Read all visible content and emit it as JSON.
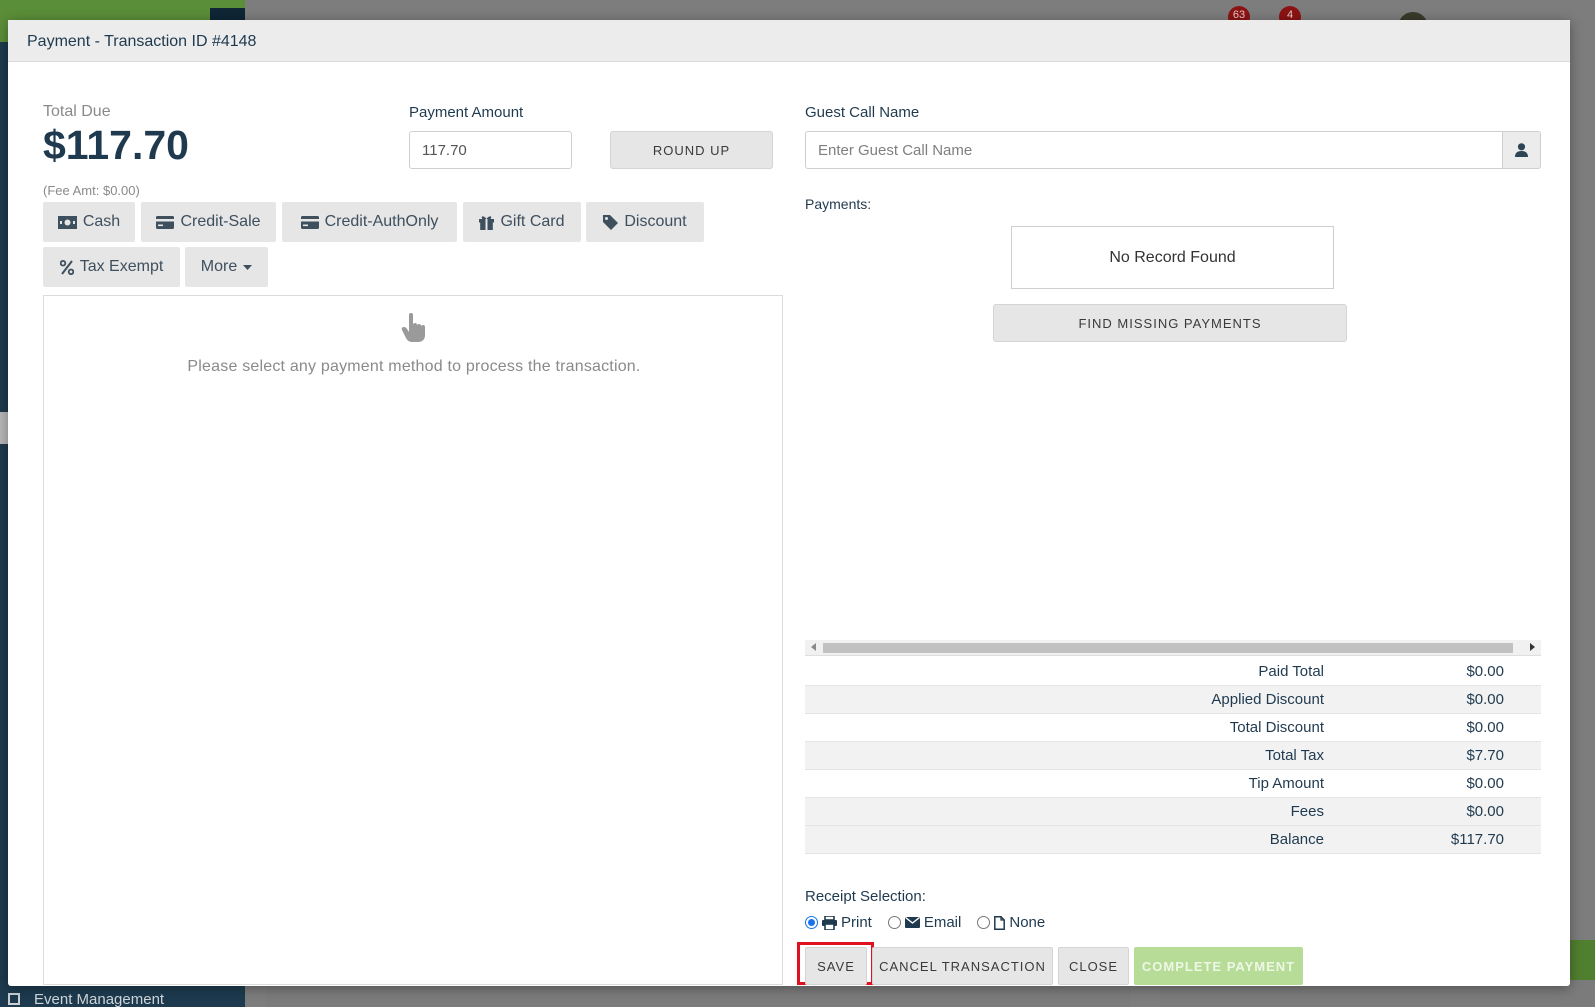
{
  "background": {
    "badges": [
      "63",
      "4"
    ],
    "sidebar_footer_item": "Event Management"
  },
  "modal": {
    "title": "Payment - Transaction ID #4148"
  },
  "left": {
    "total_due_label": "Total Due",
    "total_due_amount": "$117.70",
    "fee_amt": "(Fee Amt: $0.00)",
    "payment_amount_label": "Payment Amount",
    "payment_amount_value": "117.70",
    "round_up_label": "ROUND UP",
    "payment_methods": {
      "cash": "Cash",
      "credit_sale": "Credit-Sale",
      "credit_auth_only": "Credit-AuthOnly",
      "gift_card": "Gift Card",
      "discount": "Discount",
      "tax_exempt": "Tax Exempt",
      "more": "More"
    },
    "process_message": "Please select any payment method to process the transaction."
  },
  "right": {
    "guest_call_name_label": "Guest Call Name",
    "guest_call_name_placeholder": "Enter Guest Call Name",
    "payments_label": "Payments:",
    "no_record": "No Record Found",
    "find_missing_label": "FIND MISSING PAYMENTS",
    "totals": [
      {
        "label": "Paid Total",
        "value": "$0.00"
      },
      {
        "label": "Applied Discount",
        "value": "$0.00"
      },
      {
        "label": "Total Discount",
        "value": "$0.00"
      },
      {
        "label": "Total Tax",
        "value": "$7.70"
      },
      {
        "label": "Tip Amount",
        "value": "$0.00"
      },
      {
        "label": "Fees",
        "value": "$0.00"
      },
      {
        "label": "Balance",
        "value": "$117.70"
      }
    ],
    "receipt_selection_label": "Receipt Selection:",
    "receipt_options": {
      "print": "Print",
      "email": "Email",
      "none": "None",
      "selected": "print"
    },
    "buttons": {
      "save": "SAVE",
      "cancel_transaction": "CANCEL TRANSACTION",
      "close": "CLOSE",
      "complete_payment": "COMPLETE PAYMENT"
    }
  },
  "colors": {
    "primary_text": "#1f3a4f",
    "muted_text": "#8a8a8a",
    "highlight_red": "#e0101e",
    "complete_green": "#b7dc98",
    "radio_blue": "#1a73e8"
  }
}
